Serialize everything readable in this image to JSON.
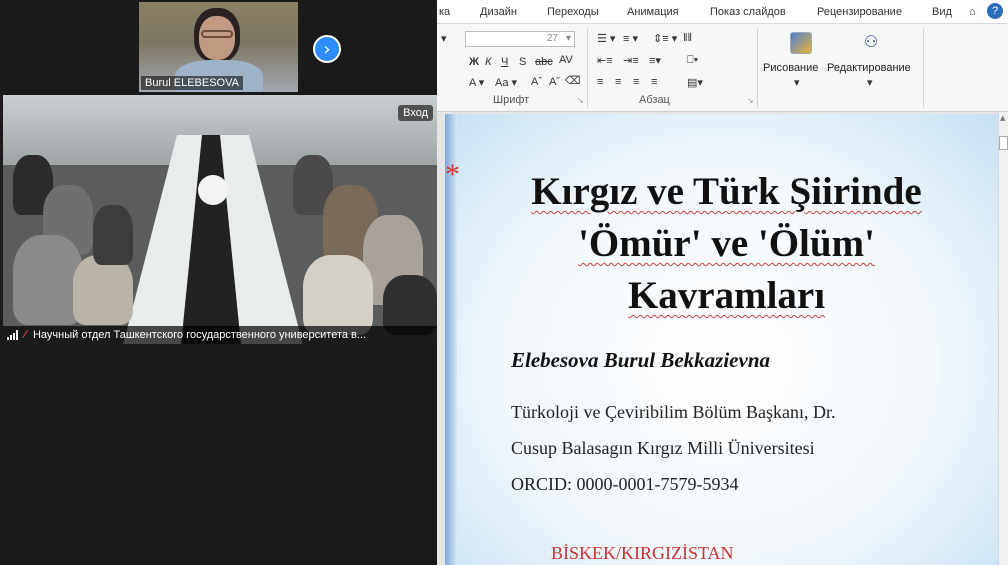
{
  "zoom": {
    "self_name": "Burul ELEBESOVA",
    "next_glyph": "›",
    "room_language_button": "Вход",
    "room_caption": "Научный отдел Ташкентского государственного университета в..."
  },
  "ppt": {
    "menu": [
      "ка",
      "Дизайн",
      "Переходы",
      "Анимация",
      "Показ слайдов",
      "Рецензирование",
      "Вид"
    ],
    "ribbon": {
      "font_size": "27",
      "font_group_label": "Шрифт",
      "paragraph_group_label": "Абзац",
      "drawing_label": "Рисование",
      "editing_label": "Редактирование"
    },
    "slide": {
      "bullet": "*",
      "title_lines": [
        "Kırgız ve Türk Şiirinde",
        "'Ömür' ve 'Ölüm'",
        "Kavramları"
      ],
      "author": "Elebesova Burul Bekkazievna",
      "position": "Türkoloji ve Çeviribilim Bölüm Başkanı, Dr.",
      "university": "Cusup Balasagın Kırgız Milli Üniversitesi",
      "orcid": "ORCID: 0000-0001-7579-5934",
      "city": "BİSKEK/KIRGIZİSTAN"
    }
  },
  "colors": {
    "zoom_accent": "#2d8cff",
    "slide_red": "#d03030",
    "zoom_bg": "#1a1a1a"
  }
}
